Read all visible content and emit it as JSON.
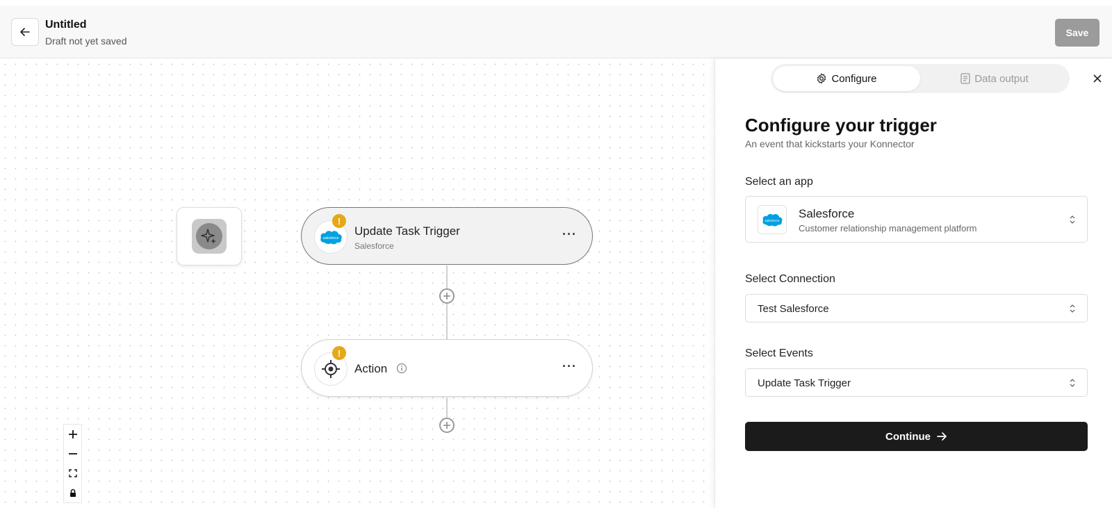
{
  "header": {
    "title": "Untitled",
    "subtitle": "Draft not yet saved",
    "save_label": "Save"
  },
  "canvas": {
    "ai_node_icon": "sparkles-icon",
    "trigger_node": {
      "title": "Update Task Trigger",
      "subtitle": "Salesforce",
      "warning": "!",
      "menu": "···"
    },
    "action_node": {
      "title": "Action",
      "warning": "!",
      "menu": "···"
    },
    "zoom_controls": [
      "zoom-in",
      "zoom-out",
      "fit-view",
      "lock"
    ]
  },
  "panel": {
    "tabs": [
      {
        "label": "Configure",
        "icon": "gear-icon",
        "active": true
      },
      {
        "label": "Data output",
        "icon": "document-icon",
        "active": false
      }
    ],
    "title": "Configure your trigger",
    "subtitle": "An event that kickstarts your Konnector",
    "app_field": {
      "label": "Select an app",
      "app_name": "Salesforce",
      "app_description": "Customer relationship management platform",
      "logo_text": "salesforce"
    },
    "connection_field": {
      "label": "Select Connection",
      "value": "Test Salesforce"
    },
    "events_field": {
      "label": "Select Events",
      "value": "Update Task Trigger"
    },
    "continue_label": "Continue"
  },
  "colors": {
    "warning": "#e6a817",
    "salesforce_blue": "#00a1e0",
    "primary_button": "#1b1b1b",
    "save_disabled": "#9b9b9b"
  }
}
